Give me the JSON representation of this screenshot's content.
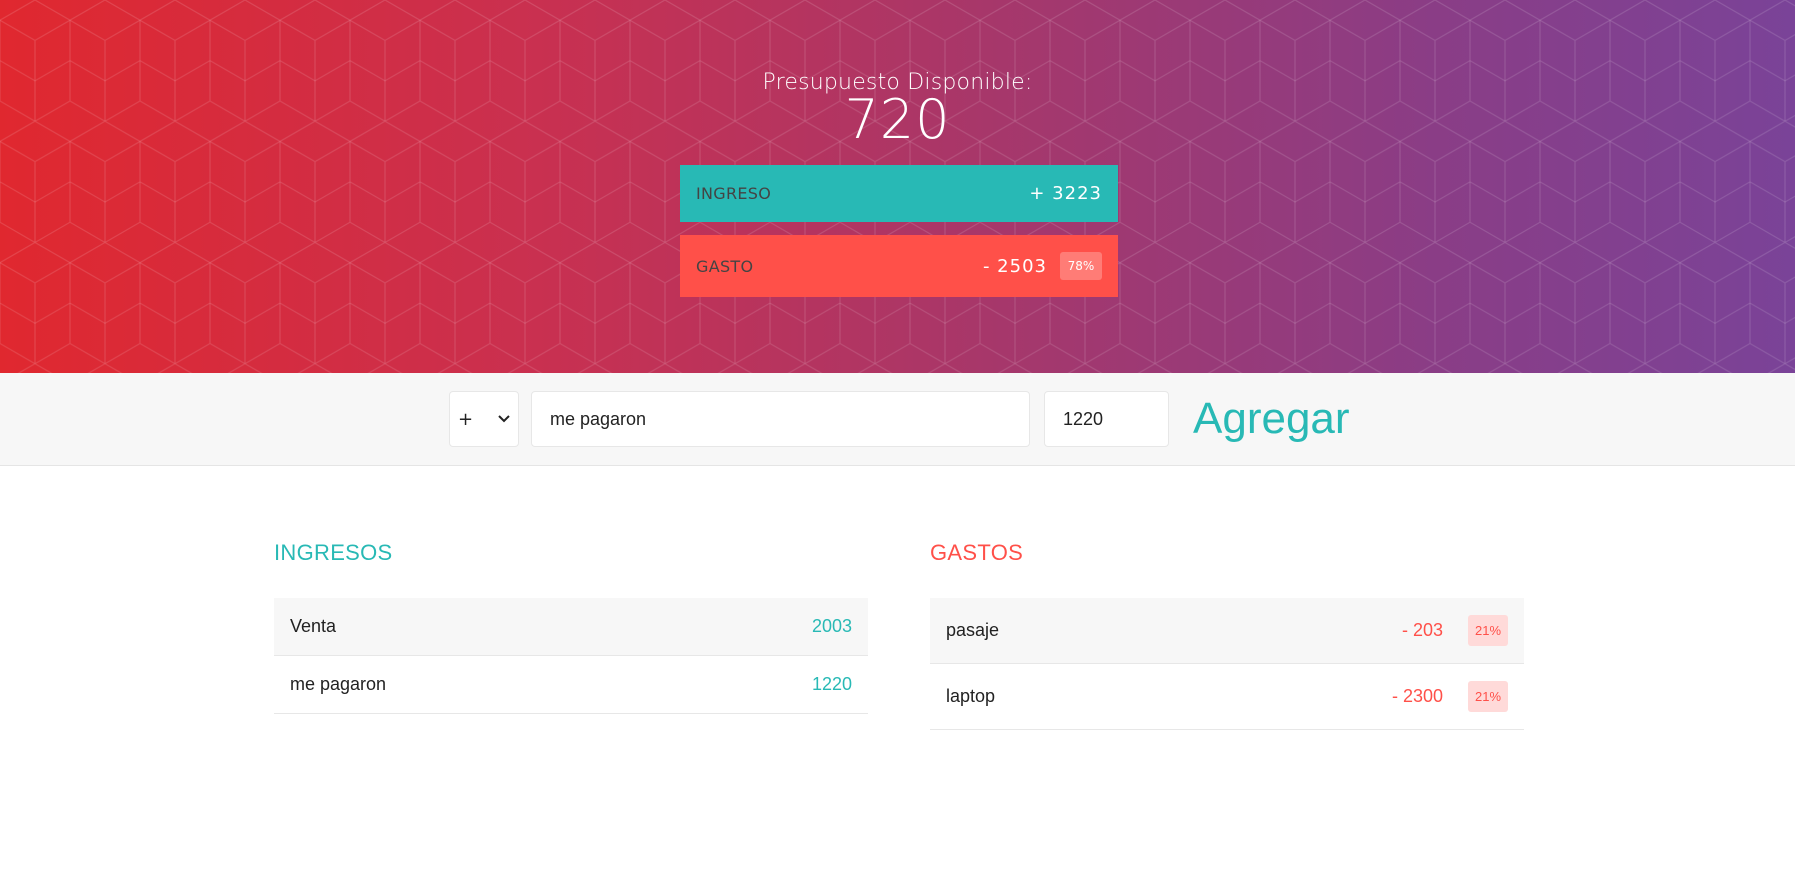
{
  "header": {
    "title": "Presupuesto Disponible:",
    "value": "720",
    "income": {
      "label": "Ingreso",
      "value": "+ 3223"
    },
    "expense": {
      "label": "Gasto",
      "value": "- 2503",
      "percent": "78%"
    }
  },
  "add_form": {
    "type_value": "+",
    "description_value": "me pagaron",
    "amount_value": "1220",
    "submit_label": "Agregar"
  },
  "income_list": {
    "title": "Ingresos",
    "items": [
      {
        "description": "Venta",
        "value": "2003"
      },
      {
        "description": "me pagaron",
        "value": "1220"
      }
    ]
  },
  "expense_list": {
    "title": "Gastos",
    "items": [
      {
        "description": "pasaje",
        "value": "- 203",
        "percent": "21%"
      },
      {
        "description": "laptop",
        "value": "- 2300",
        "percent": "21%"
      }
    ]
  },
  "colors": {
    "income": "#28b9b5",
    "expense": "#ff5049",
    "gradient_start": "#e0282f",
    "gradient_end": "#7a4398"
  }
}
